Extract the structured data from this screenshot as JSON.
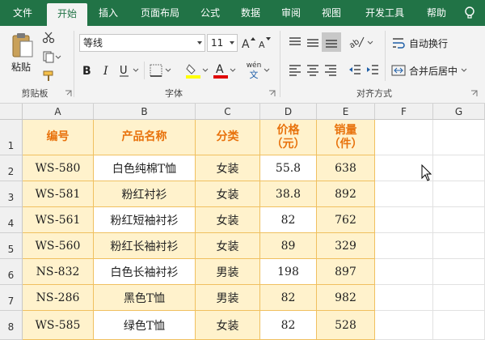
{
  "tabs": [
    {
      "label": "文件",
      "active": false
    },
    {
      "label": "开始",
      "active": true
    },
    {
      "label": "插入",
      "active": false
    },
    {
      "label": "页面布局",
      "active": false
    },
    {
      "label": "公式",
      "active": false
    },
    {
      "label": "数据",
      "active": false
    },
    {
      "label": "审阅",
      "active": false
    },
    {
      "label": "视图",
      "active": false
    },
    {
      "label": "开发工具",
      "active": false
    },
    {
      "label": "帮助",
      "active": false
    }
  ],
  "ribbon": {
    "clipboard": {
      "paste_label": "粘贴",
      "group_label": "剪贴板"
    },
    "font": {
      "font_name": "等线",
      "font_size": "11",
      "group_label": "字体",
      "phonetic_top": "wén",
      "phonetic_bottom": "文"
    },
    "alignment": {
      "wrap_label": "自动换行",
      "merge_label": "合并后居中",
      "group_label": "对齐方式"
    }
  },
  "colors": {
    "brand": "#217346",
    "header_text": "#e8720c",
    "band": "#fff2cc",
    "border": "#f0c060"
  },
  "grid": {
    "columns": [
      "A",
      "B",
      "C",
      "D",
      "E",
      "F",
      "G"
    ],
    "rows": [
      "1",
      "2",
      "3",
      "4",
      "5",
      "6",
      "7",
      "8"
    ]
  },
  "table": {
    "headers": [
      {
        "line1": "编号",
        "line2": ""
      },
      {
        "line1": "产品名称",
        "line2": ""
      },
      {
        "line1": "分类",
        "line2": ""
      },
      {
        "line1": "价格",
        "line2": "（元）"
      },
      {
        "line1": "销量",
        "line2": "（件）"
      }
    ],
    "rows": [
      [
        "WS-580",
        "白色纯棉T恤",
        "女装",
        "55.8",
        "638"
      ],
      [
        "WS-581",
        "粉红衬衫",
        "女装",
        "38.8",
        "892"
      ],
      [
        "WS-561",
        "粉红短袖衬衫",
        "女装",
        "82",
        "762"
      ],
      [
        "WS-560",
        "粉红长袖衬衫",
        "女装",
        "89",
        "329"
      ],
      [
        "NS-832",
        "白色长袖衬衫",
        "男装",
        "198",
        "897"
      ],
      [
        "NS-286",
        "黑色T恤",
        "男装",
        "82",
        "982"
      ],
      [
        "WS-585",
        "绿色T恤",
        "女装",
        "82",
        "528"
      ]
    ]
  }
}
